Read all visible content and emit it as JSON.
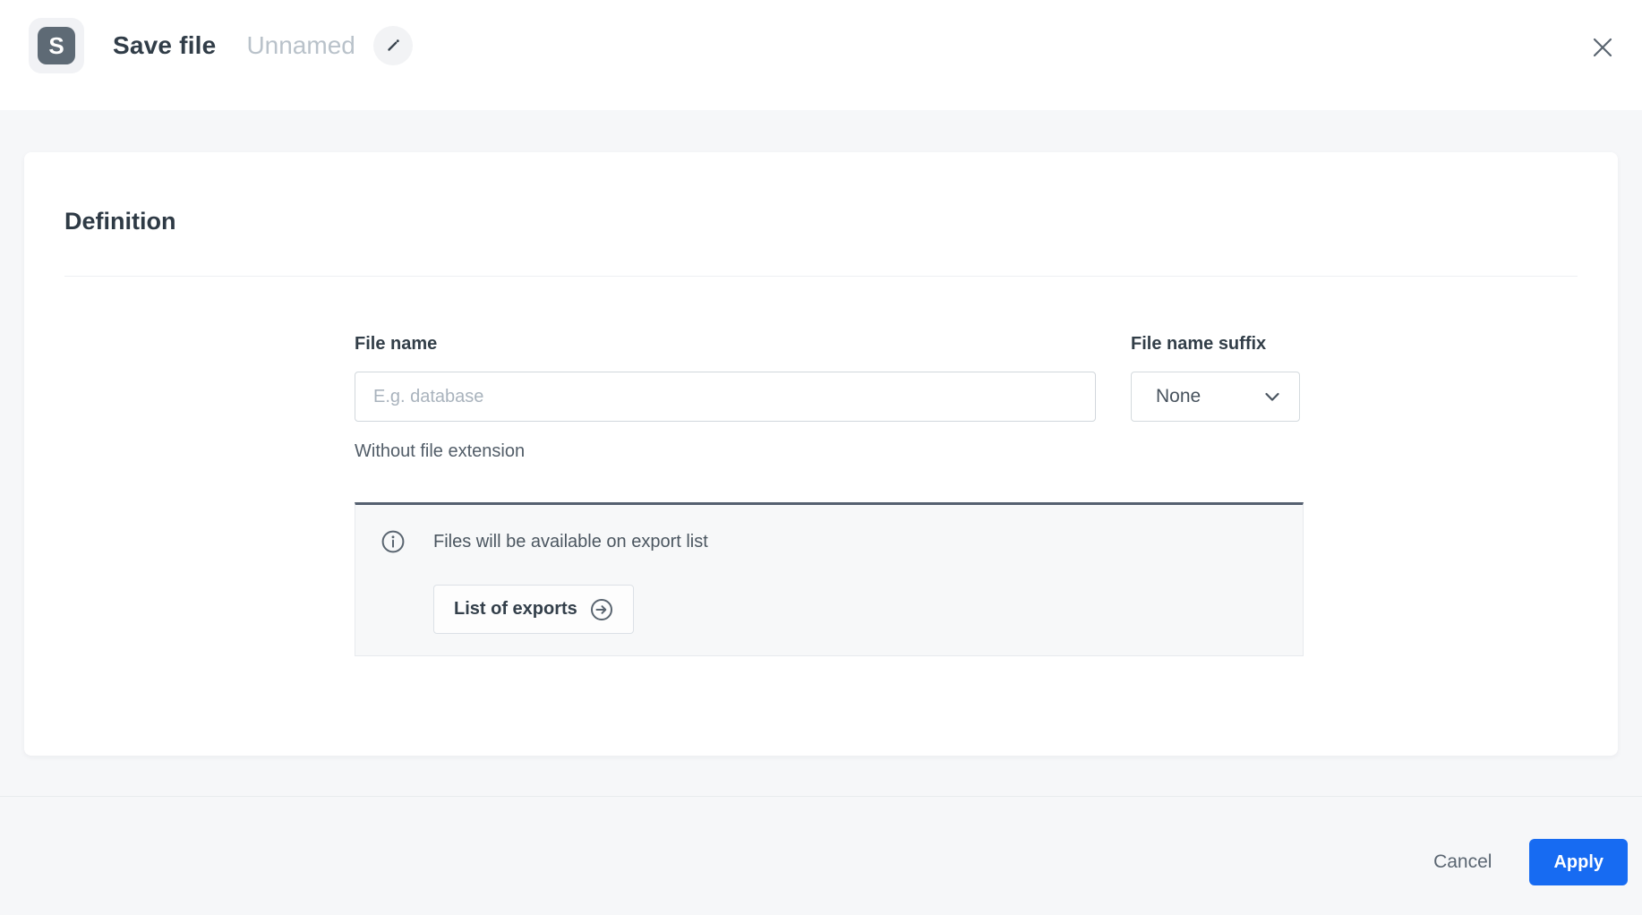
{
  "header": {
    "app_initial": "S",
    "title": "Save file",
    "subtitle": "Unnamed"
  },
  "card": {
    "section_title": "Definition"
  },
  "form": {
    "file_name": {
      "label": "File name",
      "placeholder": "E.g. database",
      "value": "",
      "helper": "Without file extension"
    },
    "suffix": {
      "label": "File name suffix",
      "selected": "None"
    }
  },
  "info": {
    "message": "Files will be available on export list",
    "button_label": "List of exports"
  },
  "footer": {
    "cancel_label": "Cancel",
    "apply_label": "Apply"
  },
  "icons": {
    "edit": "pencil-icon",
    "close": "close-icon",
    "info": "info-circle-icon",
    "arrow": "arrow-right-circle-icon",
    "chevron": "chevron-down-icon"
  },
  "colors": {
    "accent_blue": "#176bf2",
    "dark_slate": "#2e3a45",
    "muted_text": "#525d68",
    "placeholder": "#a9b3bd",
    "subtitle_gray": "#b9c2ca",
    "panel_top_border": "#556070",
    "page_background": "#f6f7f9",
    "app_tile": "#5e6a75"
  }
}
